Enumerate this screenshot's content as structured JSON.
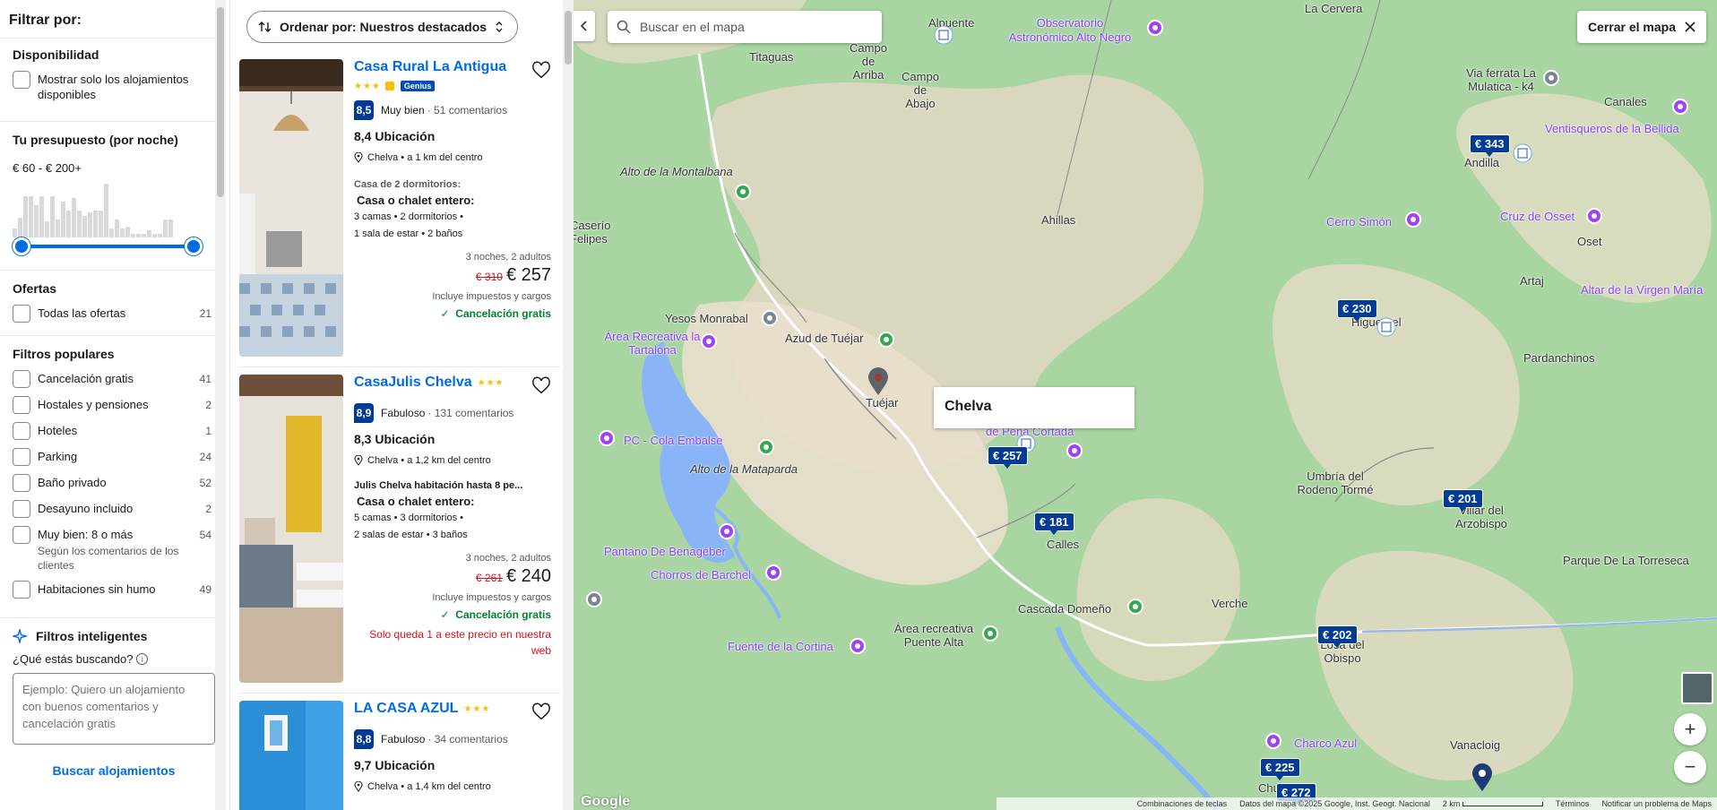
{
  "filters": {
    "title": "Filtrar por:",
    "availability": {
      "heading": "Disponibilidad",
      "option": "Mostrar solo los alojamientos disponibles"
    },
    "budget": {
      "heading": "Tu presupuesto (por noche)",
      "range": "€ 60 - € 200+",
      "min_value_fraction": 0.0,
      "max_value_fraction": 1.0
    },
    "offers": {
      "heading": "Ofertas",
      "items": [
        {
          "label": "Todas las ofertas",
          "count": "21"
        }
      ]
    },
    "popular": {
      "heading": "Filtros populares",
      "items": [
        {
          "label": "Cancelación gratis",
          "count": "41",
          "sub": ""
        },
        {
          "label": "Hostales y pensiones",
          "count": "2",
          "sub": ""
        },
        {
          "label": "Hoteles",
          "count": "1",
          "sub": ""
        },
        {
          "label": "Parking",
          "count": "24",
          "sub": ""
        },
        {
          "label": "Baño privado",
          "count": "52",
          "sub": ""
        },
        {
          "label": "Desayuno incluido",
          "count": "2",
          "sub": ""
        },
        {
          "label": "Muy bien: 8 o más",
          "count": "54",
          "sub": "Según los comentarios de los clientes"
        },
        {
          "label": "Habitaciones sin humo",
          "count": "49",
          "sub": ""
        }
      ]
    },
    "smart": {
      "heading": "Filtros inteligentes",
      "question": "¿Qué estás buscando?",
      "placeholder": "Ejemplo: Quiero un alojamiento con buenos comentarios y cancelación gratis",
      "button": "Buscar alojamientos"
    }
  },
  "results": {
    "sort_label": "Ordenar por: Nuestros destacados",
    "cards": [
      {
        "name": "Casa Rural La Antigua",
        "stars": "★★★",
        "genius": "Genius",
        "score": "8,5",
        "score_word": "Muy bien",
        "reviews": "· 51 comentarios",
        "location_score": "8,4 Ubicación",
        "location": "Chelva • a 1 km del centro",
        "room_type": "Casa de 2 dormitorios:",
        "room_title": "Casa o chalet entero:",
        "room_desc": [
          "3 camas • 2 dormitorios •",
          "1 sala de estar • 2 baños"
        ],
        "nights": "3 noches, 2 adultos",
        "old_price": "€ 310",
        "price": "€ 257",
        "taxes": "Incluye impuestos y cargos",
        "cancel": "Cancelación gratis",
        "warning": ""
      },
      {
        "name": "CasaJulis Chelva",
        "stars": "★★★",
        "genius": "",
        "score": "8,9",
        "score_word": "Fabuloso",
        "reviews": "· 131 comentarios",
        "location_score": "8,3 Ubicación",
        "location": "Chelva • a 1,2 km del centro",
        "room_type": "Julis Chelva habitación hasta 8 pe...",
        "room_title": "Casa o chalet entero:",
        "room_desc": [
          "5 camas • 3 dormitorios •",
          "2 salas de estar • 3 baños"
        ],
        "nights": "3 noches, 2 adultos",
        "old_price": "€ 261",
        "price": "€ 240",
        "taxes": "Incluye impuestos y cargos",
        "cancel": "Cancelación gratis",
        "warning": "Solo queda 1 a este precio en nuestra web"
      },
      {
        "name": "LA CASA AZUL",
        "stars": "★★★",
        "genius": "",
        "score": "8,8",
        "score_word": "Fabuloso",
        "reviews": "· 34 comentarios",
        "location_score": "9,7 Ubicación",
        "location": "Chelva • a 1,4 km del centro"
      }
    ]
  },
  "map": {
    "search_placeholder": "Buscar en el mapa",
    "close_label": "Cerrar el mapa",
    "popup": "Chelva",
    "labels": {
      "alpuente": "Alpuente",
      "observatorio": "Observatorio Astronómico Alto Negro",
      "la_cervera": "La Cervera",
      "titaguas": "Titaguas",
      "campo_arriba": "Campo de Arriba",
      "campo_abajo": "Campo de Abajo",
      "via_ferrata": "Via ferrata La Mulatica - k4",
      "canales": "Canales",
      "ventisqueros": "Ventisqueros de la Bellida",
      "andilla": "Andilla",
      "alto_montalbana": "Alto de la Montalbana",
      "caserio": "Caserío Felipes",
      "ahillas": "Ahillas",
      "cerro_simon": "Cerro Simón",
      "cruz_osset": "Cruz de Osset",
      "oset": "Oset",
      "artaj": "Artaj",
      "altar": "Altar de la Virgen María",
      "higueruelas": "Higueruel",
      "yesos": "Yesos Monrabal",
      "area_tartalona": "Área Recreativa la Tartalona",
      "azud": "Azud de Tuéjar",
      "pardanchinos": "Pardanchinos",
      "tuejar": "Tuéjar",
      "pena_cortada": "de Peña Cortada",
      "pc_cola": "PC - Cola Embalse",
      "alto_mataparda": "Alto de la Mataparda",
      "umbria": "Umbría del Rodeno Tormé",
      "villar": "Villar del Arzobispo",
      "calles": "Calles",
      "parque": "Parque De La Torreseca",
      "pantano": "Pantano De Benagéber",
      "chorros": "Chorros de Barchel",
      "cascada": "Cascada Domeño",
      "verche": "Verche",
      "area_puente": "Área recreativa Puente Alta",
      "losa": "Losa del Obispo",
      "fuente": "Fuente de la Cortina",
      "charco": "Charco Azul",
      "vanacloig": "Vanacloig",
      "chulilla": "Chu"
    },
    "prices": [
      "€ 343",
      "€ 230",
      "€ 257",
      "€ 181",
      "€ 201",
      "€ 202",
      "€ 225",
      "€ 272"
    ],
    "zoom_in": "+",
    "zoom_out": "−",
    "attribution": {
      "google": "Google",
      "shortcuts": "Combinaciones de teclas",
      "data": "Datos del mapa ©2025 Google, Inst. Geogr. Nacional",
      "scale": "2 km",
      "terms": "Términos",
      "report": "Notificar un problema de Maps"
    }
  }
}
